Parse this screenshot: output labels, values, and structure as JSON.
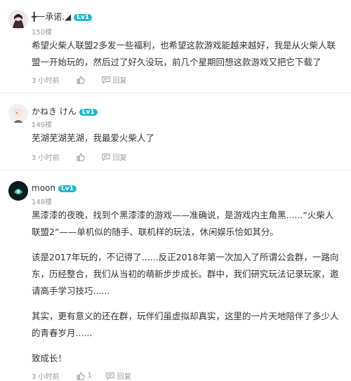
{
  "comments": [
    {
      "name": "╋一承诺.◢",
      "level": "Lv1",
      "floor": "150楼",
      "paragraphs": [
        "希望火柴人联盟2多发一些福利，也希望这款游戏能越来越好，我是从火柴人联盟一开始玩的，然后过了好久没玩，前几个星期回想这款游戏又把它下载了"
      ],
      "time": "3 小时前",
      "reply_label": "回复"
    },
    {
      "name": "かねき けん",
      "level": "Lv1",
      "floor": "149楼",
      "paragraphs": [
        "芜湖芜湖芜湖，我最爱火柴人了"
      ],
      "time": "3 小时前",
      "reply_label": "回复"
    },
    {
      "name": "moon",
      "level": "Lv1",
      "floor": "148楼",
      "paragraphs": [
        "黑漆漆的夜晚，找到个黑漆漆的游戏——准确说，是游戏内主角黑......“火柴人联盟2”——单机似的随手、联机样的玩法，休闲娱乐恰如其分。",
        "该是2017年玩的，不记得了......反正2018年第一次加入了所谓公会群，一路向东，历经整合，我们从当初的萌新步步成长。群中，我们研究玩法记录玩家，邀请高手学习技巧......",
        "其实，更有意义的还在群，玩伴们虽虚拟却真实，这里的一片天地陪伴了多少人的青春岁月......",
        "致成长！"
      ],
      "time": "3 小时前",
      "like_count": "1",
      "reply_label": "回复"
    }
  ],
  "colors": {
    "level_badge": "#22b8cf",
    "meta_text": "#999999",
    "body_text": "#333333"
  }
}
